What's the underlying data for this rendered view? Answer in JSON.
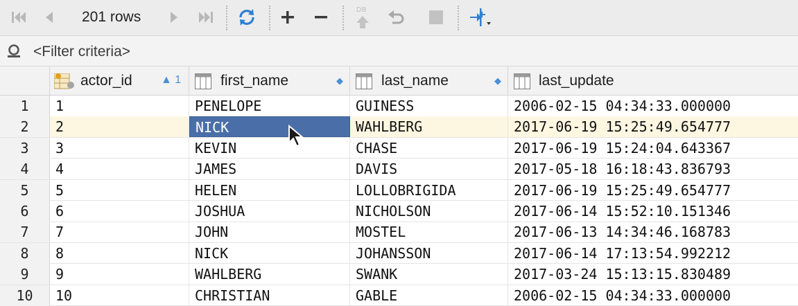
{
  "toolbar": {
    "rows_label": "201 rows",
    "db_label": "DB",
    "buttons": [
      {
        "name": "first-page",
        "icon": "first-page-icon"
      },
      {
        "name": "previous-page",
        "icon": "previous-page-icon"
      },
      {
        "name": "next-page",
        "icon": "next-page-icon"
      },
      {
        "name": "last-page",
        "icon": "last-page-icon"
      },
      {
        "name": "reload",
        "icon": "reload-icon"
      },
      {
        "name": "add-row",
        "icon": "plus-icon"
      },
      {
        "name": "delete-row",
        "icon": "minus-icon"
      },
      {
        "name": "submit-to-db",
        "icon": "db-submit-icon"
      },
      {
        "name": "revert",
        "icon": "undo-icon"
      },
      {
        "name": "stop",
        "icon": "stop-icon"
      },
      {
        "name": "compare",
        "icon": "compare-arrows-icon"
      }
    ]
  },
  "filter": {
    "placeholder": "<Filter criteria>"
  },
  "columns": [
    {
      "key": "actor_id",
      "label": "actor_id",
      "sort": "▲ 1",
      "icon": "key-column-icon"
    },
    {
      "key": "first_name",
      "label": "first_name",
      "sort": "◆",
      "icon": "column-icon"
    },
    {
      "key": "last_name",
      "label": "last_name",
      "sort": "◆",
      "icon": "column-icon"
    },
    {
      "key": "last_update",
      "label": "last_update",
      "sort": "",
      "icon": "column-icon"
    }
  ],
  "rows": [
    {
      "n": "1",
      "actor_id": "1",
      "first_name": "PENELOPE",
      "last_name": "GUINESS",
      "last_update": "2006-02-15 04:34:33.000000"
    },
    {
      "n": "2",
      "actor_id": "2",
      "first_name": "NICK",
      "last_name": "WAHLBERG",
      "last_update": "2017-06-19 15:25:49.654777"
    },
    {
      "n": "3",
      "actor_id": "3",
      "first_name": "KEVIN",
      "last_name": "CHASE",
      "last_update": "2017-06-19 15:24:04.643367"
    },
    {
      "n": "4",
      "actor_id": "4",
      "first_name": "JAMES",
      "last_name": "DAVIS",
      "last_update": "2017-05-18 16:18:43.836793"
    },
    {
      "n": "5",
      "actor_id": "5",
      "first_name": "HELEN",
      "last_name": "LOLLOBRIGIDA",
      "last_update": "2017-06-19 15:25:49.654777"
    },
    {
      "n": "6",
      "actor_id": "6",
      "first_name": "JOSHUA",
      "last_name": "NICHOLSON",
      "last_update": "2017-06-14 15:52:10.151346"
    },
    {
      "n": "7",
      "actor_id": "7",
      "first_name": "JOHN",
      "last_name": "MOSTEL",
      "last_update": "2017-06-13 14:34:46.168783"
    },
    {
      "n": "8",
      "actor_id": "8",
      "first_name": "NICK",
      "last_name": "JOHANSSON",
      "last_update": "2017-06-14 17:13:54.992212"
    },
    {
      "n": "9",
      "actor_id": "9",
      "first_name": "WAHLBERG",
      "last_name": "SWANK",
      "last_update": "2017-03-24 15:13:15.830489"
    },
    {
      "n": "10",
      "actor_id": "10",
      "first_name": "CHRISTIAN",
      "last_name": "GABLE",
      "last_update": "2006-02-15 04:34:33.000000"
    }
  ],
  "selection": {
    "row": 1,
    "column": "first_name"
  },
  "colors": {
    "accent": "#4a6fa8",
    "selected_row": "#fdf7e2",
    "sort_indicator": "#4a8fd6"
  }
}
